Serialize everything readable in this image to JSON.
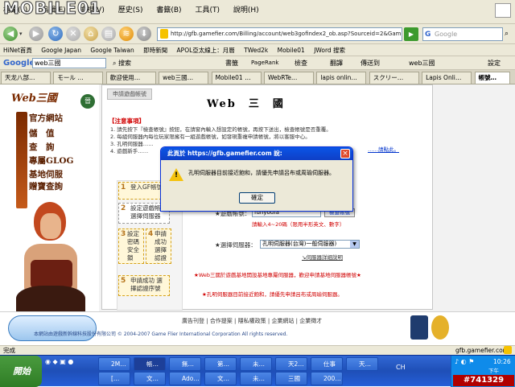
{
  "menu": {
    "items": [
      "檔案(F)",
      "編輯(E)",
      "檢視(V)",
      "歷史(S)",
      "書籤(B)",
      "工具(T)",
      "說明(H)"
    ],
    "watermark_logo": "MOBILE01"
  },
  "nav": {
    "url": "http://gfb.gamefier.com/Billing/account/web3gofindex2_ob.asp?Sourceid=2&Game=3G",
    "search_placeholder": "Google"
  },
  "bookmarks": [
    "HiNet首頁",
    "Google Japan",
    "Google Taiwan",
    "即時新聞",
    "APOL亞太線上：月曆",
    "TWed2k",
    "Mobile01",
    "JWord 搜索"
  ],
  "google_toolbar": {
    "logo": "Google",
    "query": "web三國",
    "search_btn": "搜索",
    "items": [
      "書籤",
      "PageRank",
      "檢查",
      "翻譯",
      "傳送到",
      "web三國"
    ],
    "settings": "設定"
  },
  "tabs": [
    {
      "label": "天龙八部…"
    },
    {
      "label": "モール …"
    },
    {
      "label": "歡迎使用…"
    },
    {
      "label": "web三國…"
    },
    {
      "label": "Mobile01 …"
    },
    {
      "label": "WebRTe…"
    },
    {
      "label": "lapis onlin…"
    },
    {
      "label": "スクリー…"
    },
    {
      "label": "Lapis Onli…"
    },
    {
      "label": "帳號…"
    }
  ],
  "sidebar": {
    "logo_text": "Web三國",
    "links": [
      "官方網站",
      "儲　值",
      "查　詢",
      "專屬GLOG",
      "基地伺服",
      "贈寶查詢"
    ]
  },
  "content": {
    "breadcrumb": "申請遊戲帳號",
    "heading": "Web　三　國",
    "notice_title": "【注意事項】",
    "notice_lines": [
      "1. 請先按下『檢查帳號』按鈕，在請窗內輸入想設定的帳號，再按下送出，檢查帳號是否重覆。",
      "2. 每組伺服器內每位玩家限擁有一組遊戲帳號，如發現重複申請帳號，將以客服中心。",
      "3. 孔明伺服器……",
      "4. 遊戲新手……",
      "……請點此。"
    ],
    "steps": [
      {
        "num": "1",
        "text": "登入GF帳號"
      },
      {
        "num": "2",
        "text": "設定遊戲帳號 選擇伺服器"
      },
      {
        "num": "3",
        "text": "設定 密碼 安全鎖"
      },
      {
        "num": "4",
        "text": "申請成功 選擇 認證序號"
      },
      {
        "num": "5",
        "text": "申請成功 選擇認證序號"
      }
    ],
    "account_label": "★遊戲帳號：",
    "account_value": "funyoufa",
    "check_btn": "檢查帳號",
    "account_hint": "請輸入4~20碼（限用半形英文、數字）",
    "server_label": "★選擇伺服器：",
    "server_value": "孔明伺服器(台灣)一般伺服器)",
    "server_link": "↘伺服器詳細說明",
    "red_note1": "★Web三國於遊戲基地開設基地專屬伺服器，歡迎申請基地伺服器帳號★",
    "red_note2": "★孔明伺服器目前接近飽和，請優先申請呂布或周瑜伺服器。"
  },
  "footer": {
    "links": [
      "廣告刊登",
      "合作提案",
      "隱私權政策",
      "企業網站",
      "企業徵才"
    ],
    "copyright": "本網站由遊戲新幹線科技股份有限公司 © 2004-2007 Game Flier International Corporation All rights reserved."
  },
  "dialog": {
    "title": "此頁於 https://gfb.gamefier.com 說:",
    "message": "孔明伺服器目前接近飽和，請優先申請呂布或周瑜伺服器。",
    "ok": "確定",
    "close": "×"
  },
  "statusbar": {
    "left": "完成",
    "right": "gfb.gamefier.com"
  },
  "taskbar": {
    "start": "開始",
    "items": [
      {
        "label": "2M…"
      },
      {
        "label": "帳…"
      },
      {
        "label": "無…"
      },
      {
        "label": "第…"
      },
      {
        "label": "未…"
      },
      {
        "label": "天2…"
      },
      {
        "label": "仕事"
      },
      {
        "label": "天…"
      },
      {
        "label": "[…"
      },
      {
        "label": "文…"
      },
      {
        "label": "Ado…"
      },
      {
        "label": "文…"
      },
      {
        "label": "未…"
      },
      {
        "label": "三國"
      },
      {
        "label": "200…"
      }
    ],
    "lang": "CH",
    "time": "10:26",
    "date": "下午 11:42",
    "thread_id": "#741329"
  },
  "colors": {
    "accent_blue": "#0a55e6",
    "notice_red": "#d00000",
    "sidebar_text": "#5a1f00",
    "taskbar": "#245ed8"
  }
}
